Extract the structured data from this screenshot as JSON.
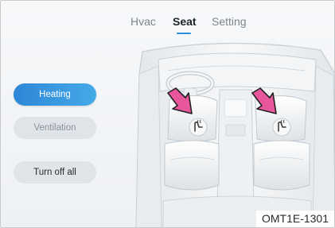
{
  "tabs": [
    {
      "label": "Hvac",
      "active": false
    },
    {
      "label": "Seat",
      "active": true
    },
    {
      "label": "Setting",
      "active": false
    }
  ],
  "sidebar": {
    "heating_label": "Heating",
    "ventilation_label": "Ventilation",
    "turn_off_label": "Turn off all"
  },
  "seats": {
    "driver_icon": "seat-heater-icon",
    "passenger_icon": "seat-heater-icon",
    "pointer_icon": "pink-arrow-icon"
  },
  "caption": "OMT1E-1301",
  "colors": {
    "accent": "#2a91d8",
    "pointer": "#e8569c"
  }
}
